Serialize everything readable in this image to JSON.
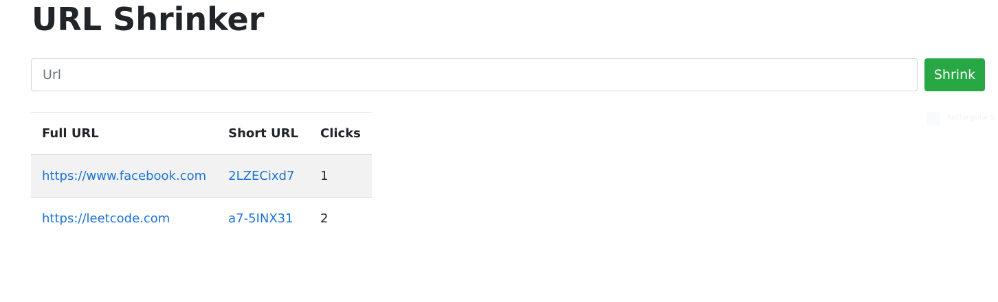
{
  "header": {
    "title": "URL Shrinker"
  },
  "form": {
    "placeholder": "Url",
    "value": "",
    "submit_label": "Shrink",
    "submit_color": "#28a745"
  },
  "table": {
    "headers": [
      "Full URL",
      "Short URL",
      "Clicks"
    ],
    "rows": [
      {
        "full_url": "https://www.facebook.com",
        "short_url": "2LZECixd7",
        "clicks": "1"
      },
      {
        "full_url": "https://leetcode.com",
        "short_url": "a7-5INX31",
        "clicks": "2"
      }
    ],
    "link_color": "#1a73d9"
  },
  "overlay": {
    "label": "Rectangular S"
  }
}
